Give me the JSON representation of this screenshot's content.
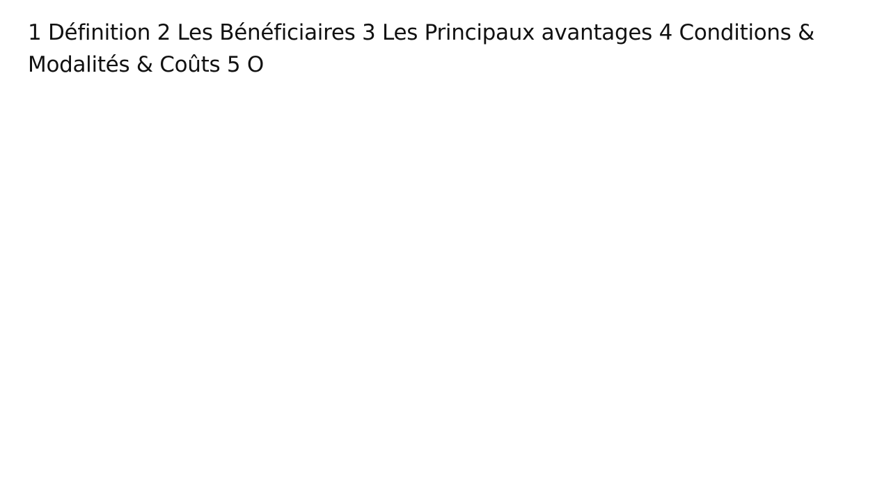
{
  "slide": {
    "outline_items": [
      "1 Définition",
      "2 Les Bénéficiaires",
      "3 Les Principaux avantages",
      "4 Conditions & Modalités & Coûts",
      "5 O"
    ]
  }
}
